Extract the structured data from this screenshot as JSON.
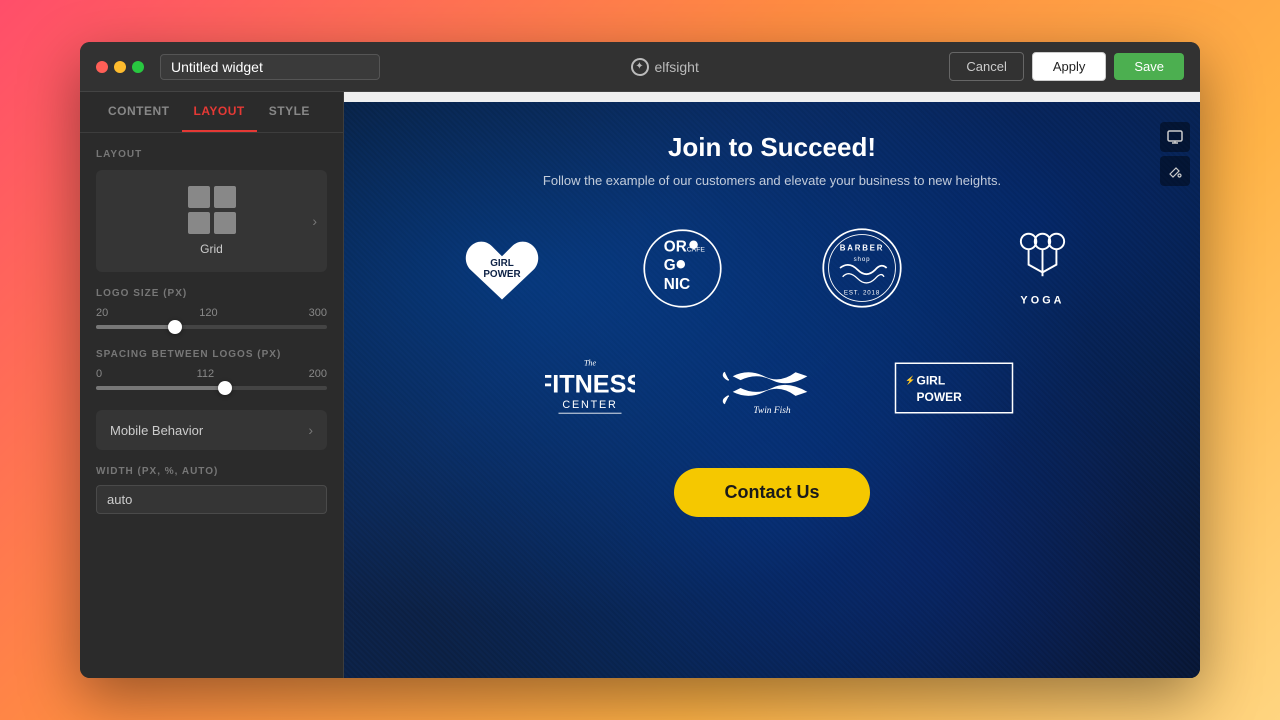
{
  "window": {
    "traffic_lights": [
      "red",
      "yellow",
      "green"
    ]
  },
  "titlebar": {
    "widget_name": "Untitled widget",
    "widget_placeholder": "Untitled widget",
    "logo_text": "elfsight",
    "cancel_label": "Cancel",
    "apply_label": "Apply",
    "save_label": "Save"
  },
  "sidebar": {
    "tabs": [
      {
        "id": "content",
        "label": "CONTENT",
        "active": false
      },
      {
        "id": "layout",
        "label": "LAYOUT",
        "active": true
      },
      {
        "id": "style",
        "label": "STYLE",
        "active": false
      }
    ],
    "layout_section": {
      "label": "LAYOUT",
      "current_layout": "Grid"
    },
    "logo_size": {
      "label": "LOGO SIZE (PX)",
      "min": 20,
      "max": 300,
      "value": 120,
      "thumb_pct": 34
    },
    "spacing": {
      "label": "SPACING BETWEEN LOGOS (PX)",
      "min": 0,
      "max": 200,
      "value": 112,
      "thumb_pct": 56
    },
    "mobile_behavior": {
      "label": "Mobile Behavior"
    },
    "width": {
      "label": "WIDTH (PX, %, AUTO)",
      "value": "auto"
    }
  },
  "preview": {
    "title": "Join to Succeed!",
    "subtitle": "Follow the example of our customers and elevate your business to new heights.",
    "contact_btn": "Contact Us",
    "logos": [
      {
        "name": "girl-power",
        "row": 1
      },
      {
        "name": "organic",
        "row": 1
      },
      {
        "name": "barber-shop",
        "row": 1
      },
      {
        "name": "yoga",
        "row": 1
      },
      {
        "name": "fitness-center",
        "row": 2
      },
      {
        "name": "twin-fish",
        "row": 2
      },
      {
        "name": "girl-power-2",
        "row": 2
      }
    ]
  },
  "colors": {
    "accent_red": "#e53935",
    "save_green": "#4caf50",
    "contact_yellow": "#f5c800"
  }
}
